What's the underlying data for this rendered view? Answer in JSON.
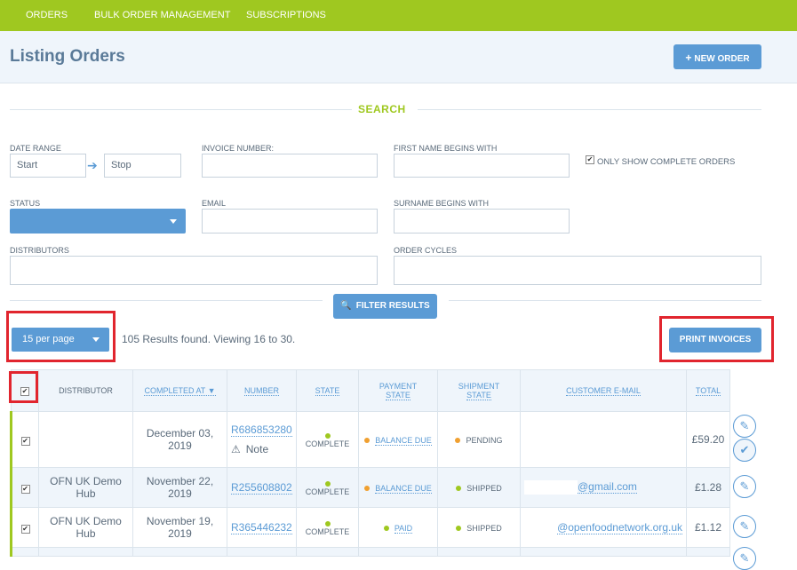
{
  "nav": {
    "tabs": [
      "ORDERS",
      "BULK ORDER MANAGEMENT",
      "SUBSCRIPTIONS"
    ]
  },
  "header": {
    "title": "Listing Orders",
    "new_order_icon": "+",
    "new_order_label": "NEW ORDER"
  },
  "search": {
    "title": "SEARCH",
    "date_range_label": "DATE RANGE",
    "start_placeholder": "Start",
    "stop_placeholder": "Stop",
    "invoice_label": "INVOICE NUMBER:",
    "first_name_label": "FIRST NAME BEGINS WITH",
    "only_complete_label": "ONLY SHOW COMPLETE ORDERS",
    "status_label": "STATUS",
    "email_label": "EMAIL",
    "surname_label": "SURNAME BEGINS WITH",
    "distributors_label": "DISTRIBUTORS",
    "order_cycles_label": "ORDER CYCLES",
    "filter_label": "FILTER RESULTS"
  },
  "results": {
    "per_page": "15 per page",
    "summary": "105 Results found. Viewing 16 to 30.",
    "print_invoices": "PRINT INVOICES"
  },
  "table": {
    "headers": {
      "distributor": "DISTRIBUTOR",
      "completed_at": "COMPLETED AT ▼",
      "number": "NUMBER",
      "state": "STATE",
      "payment_state_1": "PAYMENT",
      "payment_state_2": "STATE",
      "shipment_state_1": "SHIPMENT",
      "shipment_state_2": "STATE",
      "customer_email": "CUSTOMER E-MAIL",
      "total": "TOTAL"
    },
    "rows": [
      {
        "distributor_1": "",
        "distributor_2": "",
        "date_1": "December 03,",
        "date_2": "2019",
        "number": "R686853280",
        "note": "Note",
        "state": "COMPLETE",
        "payment": "BALANCE DUE",
        "shipment": "PENDING",
        "email": "",
        "total": "£59.20"
      },
      {
        "distributor_1": "OFN UK Demo",
        "distributor_2": "Hub",
        "date_1": "November 22,",
        "date_2": "2019",
        "number": "R255608802",
        "state": "COMPLETE",
        "payment": "BALANCE DUE",
        "shipment": "SHIPPED",
        "email": "@gmail.com",
        "total": "£1.28"
      },
      {
        "distributor_1": "OFN UK Demo",
        "distributor_2": "Hub",
        "date_1": "November 19,",
        "date_2": "2019",
        "number": "R365446232",
        "state": "COMPLETE",
        "payment": "PAID",
        "shipment": "SHIPPED",
        "email": "@openfoodnetwork.org.uk",
        "total": "£1.12"
      }
    ]
  },
  "colors": {
    "brand_green": "#9fc820",
    "accent_blue": "#5b9bd5",
    "highlight_red": "#e1252e",
    "status_orange": "#f0a030"
  },
  "icons": {
    "edit": "edit-icon",
    "ship": "check-icon",
    "search": "search-icon",
    "warning": "warning-icon",
    "arrow": "arrow-right-icon"
  }
}
